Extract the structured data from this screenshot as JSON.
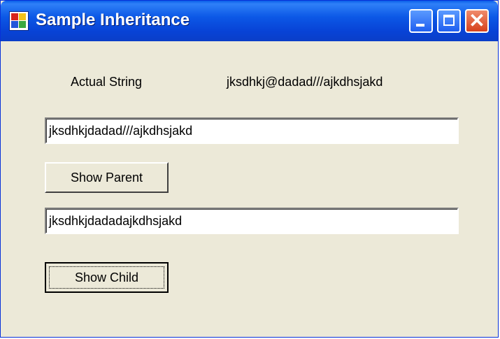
{
  "window": {
    "title": "Sample Inheritance"
  },
  "labels": {
    "actual_string_caption": "Actual String",
    "actual_string_value": "jksdhkj@dadad///ajkdhsjakd"
  },
  "parent": {
    "textbox_value": "jksdhkjdadad///ajkdhsjakd",
    "button_label": "Show Parent"
  },
  "child": {
    "textbox_value": "jksdhkjdadadajkdhsjakd",
    "button_label": "Show Child"
  },
  "icons": {
    "app": "app-icon",
    "minimize": "minimize-icon",
    "maximize": "maximize-icon",
    "close": "close-icon"
  },
  "colors": {
    "titlebar": "#0843d6",
    "client_bg": "#ece9d8",
    "close_button": "#d6411c"
  }
}
